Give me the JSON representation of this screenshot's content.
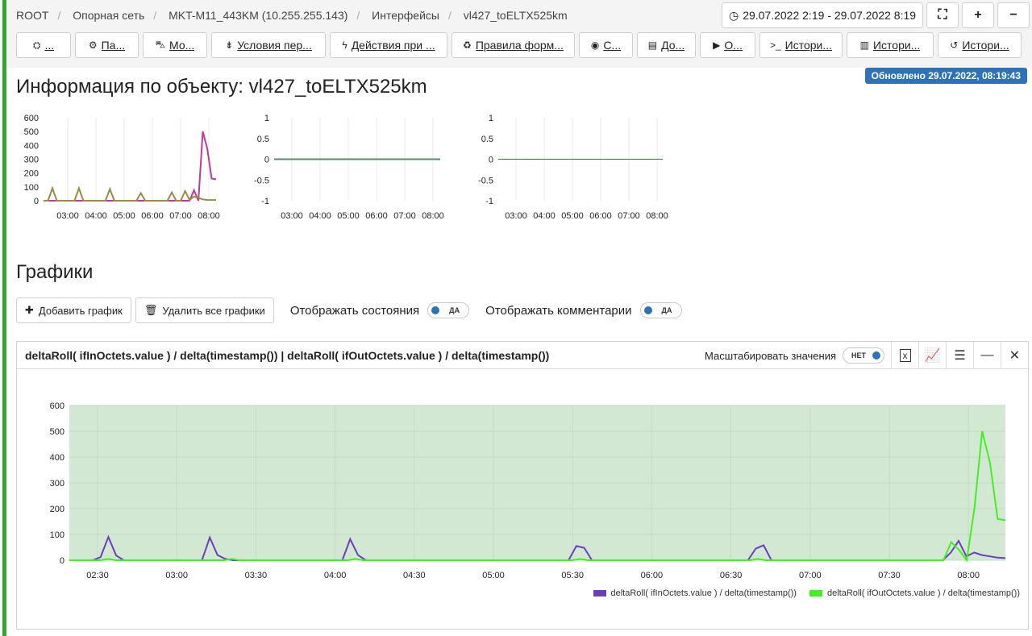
{
  "breadcrumb": [
    "ROOT",
    "Опорная сеть",
    "MKT-M11_443KM (10.255.255.143)",
    "Интерфейсы",
    "vl427_toELTX525km"
  ],
  "header": {
    "date_range": "29.07.2022 2:19 - 29.07.2022 8:19",
    "add_label": "+",
    "minus_label": "−"
  },
  "toolbar": [
    {
      "icon": "cubes-icon",
      "glyph": "⛭",
      "label": "..."
    },
    {
      "icon": "cogs-icon",
      "glyph": "⚙",
      "label": "Па..."
    },
    {
      "icon": "car-icon",
      "glyph": "⛍",
      "label": "Мо..."
    },
    {
      "icon": "signpost-icon",
      "glyph": "⇟",
      "label": "Условия пер..."
    },
    {
      "icon": "bolt-icon",
      "glyph": "ϟ",
      "label": "Действия при ..."
    },
    {
      "icon": "recycle-icon",
      "glyph": "♻",
      "label": "Правила форм..."
    },
    {
      "icon": "target-icon",
      "glyph": "◉",
      "label": "С..."
    },
    {
      "icon": "document-icon",
      "glyph": "▤",
      "label": "До..."
    },
    {
      "icon": "play-circle-icon",
      "glyph": "▶",
      "label": "О..."
    },
    {
      "icon": "terminal-icon",
      "glyph": ">_",
      "label": "Истори..."
    },
    {
      "icon": "bar-chart-icon",
      "glyph": "▥",
      "label": "Истори..."
    },
    {
      "icon": "history-icon",
      "glyph": "↺",
      "label": "Истори..."
    }
  ],
  "updated": "Обновлено 29.07.2022, 08:19:43",
  "page_title": "Информация по объекту: vl427_toELTX525km",
  "section_title": "Графики",
  "actions": {
    "add_chart": "Добавить график",
    "delete_all": "Удалить все графики",
    "show_states": "Отображать состояния",
    "show_comments": "Отображать комментарии",
    "states_toggle": "ДА",
    "comments_toggle": "ДА"
  },
  "panel": {
    "title": "deltaRoll( ifInOctets.value ) / delta(timestamp()) | deltaRoll( ifOutOctets.value ) / delta(timestamp())",
    "scale_label": "Масштабировать значения",
    "scale_toggle": "НЕТ",
    "excel_label": "x"
  },
  "colors": {
    "in": "#6a3fbf",
    "out": "#44ee22",
    "plot_bg": "#d3e8d3",
    "mini_a": "#c0399a",
    "mini_b": "#9c8a48",
    "accent": "#2e72b8"
  },
  "chart_data": [
    {
      "type": "line",
      "x_ticks": [
        "03:00",
        "04:00",
        "05:00",
        "06:00",
        "07:00",
        "08:00"
      ],
      "y_ticks": [
        "600",
        "500",
        "400",
        "300",
        "200",
        "100",
        "0"
      ],
      "ylim": [
        0,
        600
      ],
      "series": [
        {
          "values": [
            0,
            0,
            0,
            0,
            0,
            0,
            0,
            0,
            0,
            0,
            0,
            0,
            0,
            0,
            0,
            0,
            0,
            0,
            0,
            0,
            0,
            0,
            0,
            0,
            0,
            0,
            0,
            0,
            0,
            0,
            0,
            0,
            0,
            0,
            75,
            0,
            500,
            380,
            160,
            155
          ]
        },
        {
          "values": [
            0,
            0,
            90,
            0,
            0,
            0,
            0,
            0,
            90,
            0,
            0,
            0,
            0,
            0,
            0,
            85,
            0,
            0,
            0,
            0,
            0,
            0,
            55,
            0,
            0,
            0,
            0,
            0,
            0,
            60,
            0,
            0,
            70,
            5,
            30,
            20,
            10,
            5,
            5,
            5
          ]
        }
      ]
    },
    {
      "type": "line",
      "x_ticks": [
        "03:00",
        "04:00",
        "05:00",
        "06:00",
        "07:00",
        "08:00"
      ],
      "y_ticks": [
        "1",
        "0.5",
        "0",
        "-0.5",
        "-1"
      ],
      "ylim": [
        -1,
        1
      ],
      "series": [
        {
          "values": [
            0,
            0
          ]
        }
      ]
    },
    {
      "type": "line",
      "x_ticks": [
        "03:00",
        "04:00",
        "05:00",
        "06:00",
        "07:00",
        "08:00"
      ],
      "y_ticks": [
        "1",
        "0.5",
        "0",
        "-0.5",
        "-1"
      ],
      "ylim": [
        -1,
        1
      ],
      "series": [
        {
          "values": [
            0,
            0
          ]
        }
      ]
    },
    {
      "type": "line",
      "x_ticks": [
        "02:30",
        "03:00",
        "03:30",
        "04:00",
        "04:30",
        "05:00",
        "05:30",
        "06:00",
        "06:30",
        "07:00",
        "07:30",
        "08:00"
      ],
      "y_ticks": [
        "600",
        "500",
        "400",
        "300",
        "200",
        "100",
        "0"
      ],
      "ylim": [
        0,
        600
      ],
      "grid": true,
      "legend": "bottom-right",
      "series": [
        {
          "name": "deltaRoll( ifInOctets.value ) / delta(timestamp())",
          "values": [
            0,
            0,
            0,
            0,
            12,
            90,
            18,
            0,
            0,
            0,
            0,
            0,
            0,
            0,
            0,
            0,
            0,
            0,
            88,
            20,
            5,
            0,
            0,
            0,
            0,
            0,
            0,
            0,
            0,
            0,
            0,
            0,
            0,
            0,
            0,
            0,
            82,
            20,
            0,
            0,
            0,
            0,
            0,
            0,
            0,
            0,
            0,
            0,
            0,
            0,
            0,
            0,
            0,
            0,
            0,
            0,
            0,
            0,
            0,
            0,
            0,
            0,
            0,
            0,
            0,
            55,
            48,
            0,
            0,
            0,
            0,
            0,
            0,
            0,
            0,
            0,
            0,
            0,
            0,
            0,
            0,
            0,
            0,
            0,
            0,
            0,
            0,
            0,
            45,
            58,
            0,
            0,
            0,
            0,
            0,
            0,
            0,
            0,
            0,
            0,
            0,
            0,
            0,
            0,
            0,
            0,
            0,
            0,
            0,
            0,
            0,
            0,
            0,
            30,
            75,
            15,
            30,
            20,
            15,
            10,
            8
          ]
        },
        {
          "name": "deltaRoll( ifOutOctets.value ) / delta(timestamp())",
          "values": [
            0,
            0,
            0,
            0,
            0,
            5,
            0,
            0,
            0,
            0,
            0,
            0,
            0,
            0,
            0,
            0,
            0,
            0,
            0,
            0,
            0,
            5,
            0,
            0,
            0,
            0,
            0,
            0,
            0,
            0,
            0,
            0,
            0,
            0,
            0,
            0,
            0,
            5,
            0,
            0,
            0,
            0,
            0,
            0,
            0,
            0,
            0,
            0,
            0,
            0,
            0,
            0,
            0,
            0,
            0,
            0,
            0,
            0,
            0,
            0,
            0,
            0,
            0,
            0,
            0,
            0,
            5,
            0,
            0,
            0,
            0,
            0,
            0,
            0,
            0,
            0,
            0,
            0,
            0,
            0,
            0,
            0,
            0,
            0,
            0,
            0,
            0,
            0,
            0,
            5,
            0,
            0,
            0,
            0,
            0,
            0,
            0,
            0,
            0,
            0,
            0,
            0,
            0,
            0,
            0,
            0,
            0,
            0,
            0,
            0,
            0,
            0,
            0,
            0,
            70,
            40,
            0,
            200,
            500,
            380,
            160,
            155
          ]
        }
      ]
    }
  ]
}
